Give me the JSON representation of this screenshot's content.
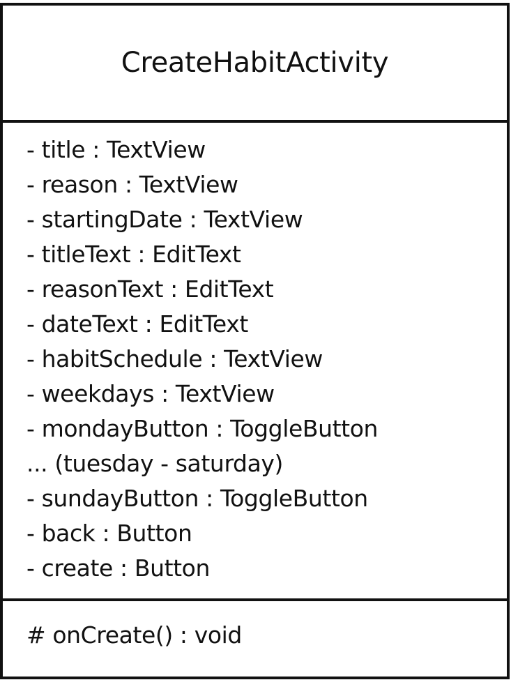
{
  "class_name": "CreateHabitActivity",
  "attributes": [
    "- title : TextView",
    "- reason : TextView",
    "- startingDate : TextView",
    "- titleText : EditText",
    "- reasonText : EditText",
    "- dateText : EditText",
    "- habitSchedule : TextView",
    "- weekdays : TextView",
    "- mondayButton : ToggleButton",
    "... (tuesday - saturday)",
    "- sundayButton : ToggleButton",
    "- back : Button",
    "- create : Button"
  ],
  "operations": [
    "# onCreate() : void"
  ],
  "colors": {
    "line": "#111111",
    "background": "#ffffff"
  }
}
